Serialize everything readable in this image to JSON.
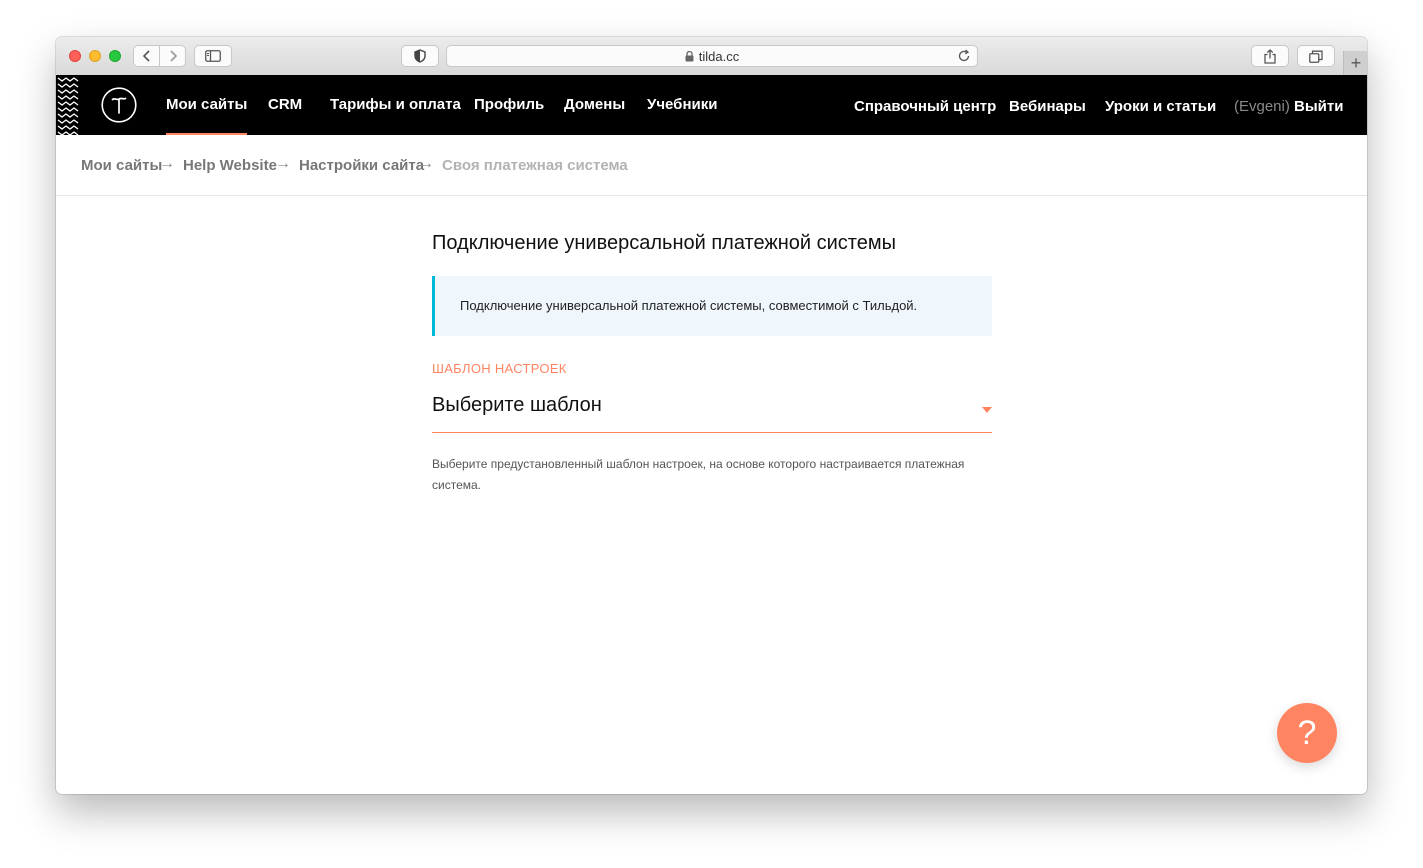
{
  "browser": {
    "url": "tilda.cc",
    "buttons": {
      "back": "chevron-left-icon",
      "forward": "chevron-right-icon",
      "sidebar": "sidebar-icon",
      "privacy": "shield-icon",
      "reload": "reload-icon",
      "share": "share-icon",
      "tabs": "tabs-icon",
      "new_tab": "+"
    }
  },
  "header": {
    "nav_left": [
      {
        "label": "Мои сайты",
        "active": true
      },
      {
        "label": "CRM"
      },
      {
        "label": "Тарифы и оплата"
      },
      {
        "label": "Профиль"
      },
      {
        "label": "Домены"
      },
      {
        "label": "Учебники"
      }
    ],
    "nav_right": [
      {
        "label": "Справочный центр"
      },
      {
        "label": "Вебинары"
      },
      {
        "label": "Уроки и статьи"
      }
    ],
    "user_prefix": "(Evgeni)",
    "logout": "Выйти",
    "accent": "#ff8562"
  },
  "breadcrumb": {
    "separator": "→",
    "items": [
      "Мои сайты",
      "Help Website",
      "Настройки сайта",
      "Своя платежная система"
    ]
  },
  "main": {
    "title": "Подключение универсальной платежной системы",
    "notice": "Подключение универсальной платежной системы, совместимой с Тильдой.",
    "field_label": "ШАБЛОН НАСТРОЕК",
    "select_value": "Выберите шаблон",
    "hint": "Выберите предустановленный шаблон настроек, на основе которого настраивается платежная система."
  },
  "help_button": "?"
}
